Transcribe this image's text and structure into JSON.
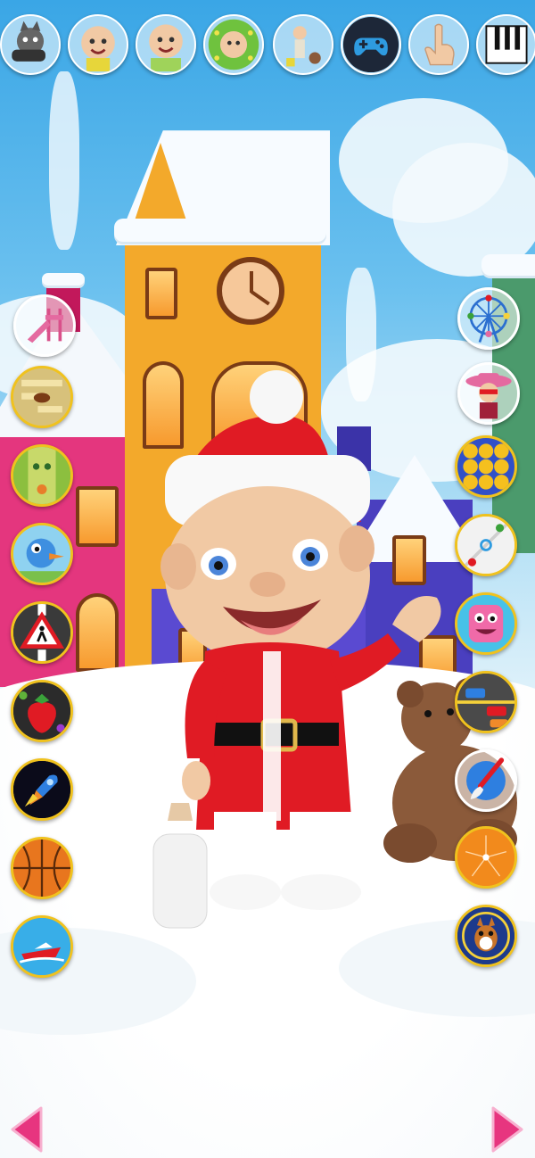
{
  "top_bar": {
    "items": [
      {
        "icon": "cat-pet-icon"
      },
      {
        "icon": "baby-avatar-icon"
      },
      {
        "icon": "baby-outfit-icon"
      },
      {
        "icon": "baby-dressup-icon"
      },
      {
        "icon": "baby-room-toys-icon"
      },
      {
        "icon": "gamepad-icon"
      },
      {
        "icon": "touch-hand-icon"
      },
      {
        "icon": "piano-icon"
      }
    ]
  },
  "left_games": [
    {
      "icon": "playground-slide-icon"
    },
    {
      "icon": "maze-game-icon"
    },
    {
      "icon": "bowling-game-icon"
    },
    {
      "icon": "bird-game-icon"
    },
    {
      "icon": "crossing-sign-game-icon"
    },
    {
      "icon": "strawberry-game-icon"
    },
    {
      "icon": "rocket-game-icon"
    },
    {
      "icon": "basketball-game-icon"
    },
    {
      "icon": "speedboat-game-icon"
    }
  ],
  "right_games": [
    {
      "icon": "ferris-wheel-icon"
    },
    {
      "icon": "cowgirl-character-icon"
    },
    {
      "icon": "emoji-grid-game-icon"
    },
    {
      "icon": "air-hockey-game-icon"
    },
    {
      "icon": "pink-monster-game-icon"
    },
    {
      "icon": "traffic-game-icon"
    },
    {
      "icon": "paint-brush-icon"
    },
    {
      "icon": "orange-dots-game-icon"
    },
    {
      "icon": "squirrel-game-icon"
    }
  ],
  "navigation": {
    "prev": "arrow-left-icon",
    "next": "arrow-right-icon"
  },
  "colors": {
    "accent_gold": "#f0c21e",
    "arrow_pink": "#e7357f",
    "santa_red": "#e01b24"
  }
}
